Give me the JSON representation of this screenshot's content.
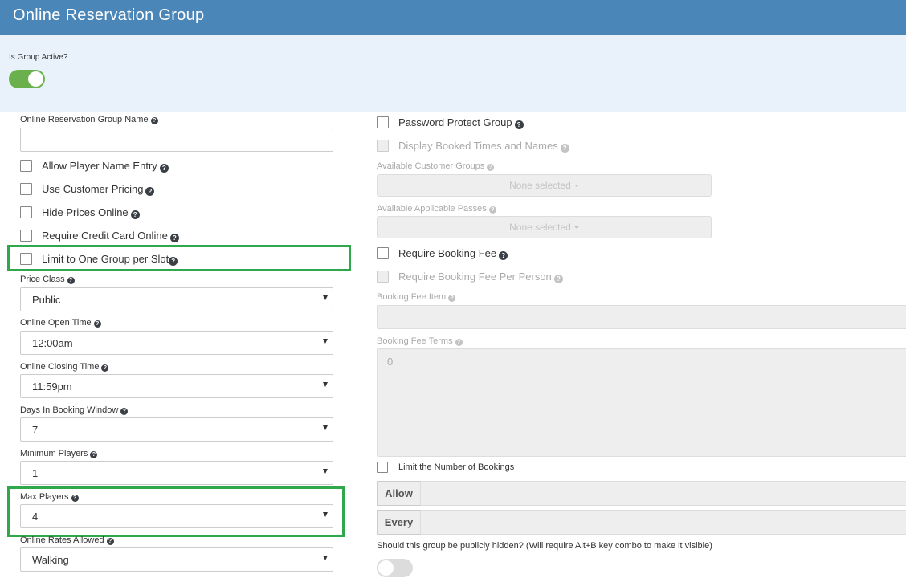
{
  "header": {
    "title": "Online Reservation Group"
  },
  "group_active": {
    "label": "Is Group Active?",
    "value": true
  },
  "left": {
    "group_name": {
      "label": "Online Reservation Group Name",
      "value": ""
    },
    "checkboxes": [
      {
        "label": "Allow Player Name Entry",
        "checked": false
      },
      {
        "label": "Use Customer Pricing",
        "checked": false
      },
      {
        "label": "Hide Prices Online",
        "checked": false
      },
      {
        "label": "Require Credit Card Online",
        "checked": false
      },
      {
        "label": "Limit to One Group per Slot",
        "checked": false
      }
    ],
    "selects": [
      {
        "label": "Price Class",
        "value": "Public"
      },
      {
        "label": "Online Open Time",
        "value": "12:00am"
      },
      {
        "label": "Online Closing Time",
        "value": "11:59pm"
      },
      {
        "label": "Days In Booking Window",
        "value": "7"
      },
      {
        "label": "Minimum Players",
        "value": "1"
      },
      {
        "label": "Max Players",
        "value": "4"
      },
      {
        "label": "Online Rates Allowed",
        "value": "Walking"
      }
    ]
  },
  "right": {
    "password_protect": {
      "label": "Password Protect Group",
      "checked": false
    },
    "display_booked": {
      "label": "Display Booked Times and Names",
      "checked": false,
      "disabled": true
    },
    "customer_groups": {
      "label": "Available Customer Groups",
      "value": "None selected"
    },
    "applicable_passes": {
      "label": "Available Applicable Passes",
      "value": "None selected"
    },
    "require_booking_fee": {
      "label": "Require Booking Fee",
      "checked": false
    },
    "booking_fee_per_person": {
      "label": "Require Booking Fee Per Person",
      "checked": false,
      "disabled": true
    },
    "booking_fee_item": {
      "label": "Booking Fee Item",
      "value": ""
    },
    "booking_fee_terms": {
      "label": "Booking Fee Terms",
      "value": "0"
    },
    "limit_bookings": {
      "label": "Limit the Number of Bookings",
      "checked": false
    },
    "allow_addon": "Allow",
    "every_addon": "Every",
    "hidden_question": "Should this group be publicly hidden? (Will require Alt+B key combo to make it visible)",
    "hidden_value": false
  },
  "colors": {
    "header": "#4a86b8",
    "panel": "#e9f1fb",
    "toggle_on": "#6ab04c",
    "highlight": "#2ea84a"
  },
  "icons": {
    "help": "question-circle-icon",
    "caret": "caret-down-icon"
  }
}
